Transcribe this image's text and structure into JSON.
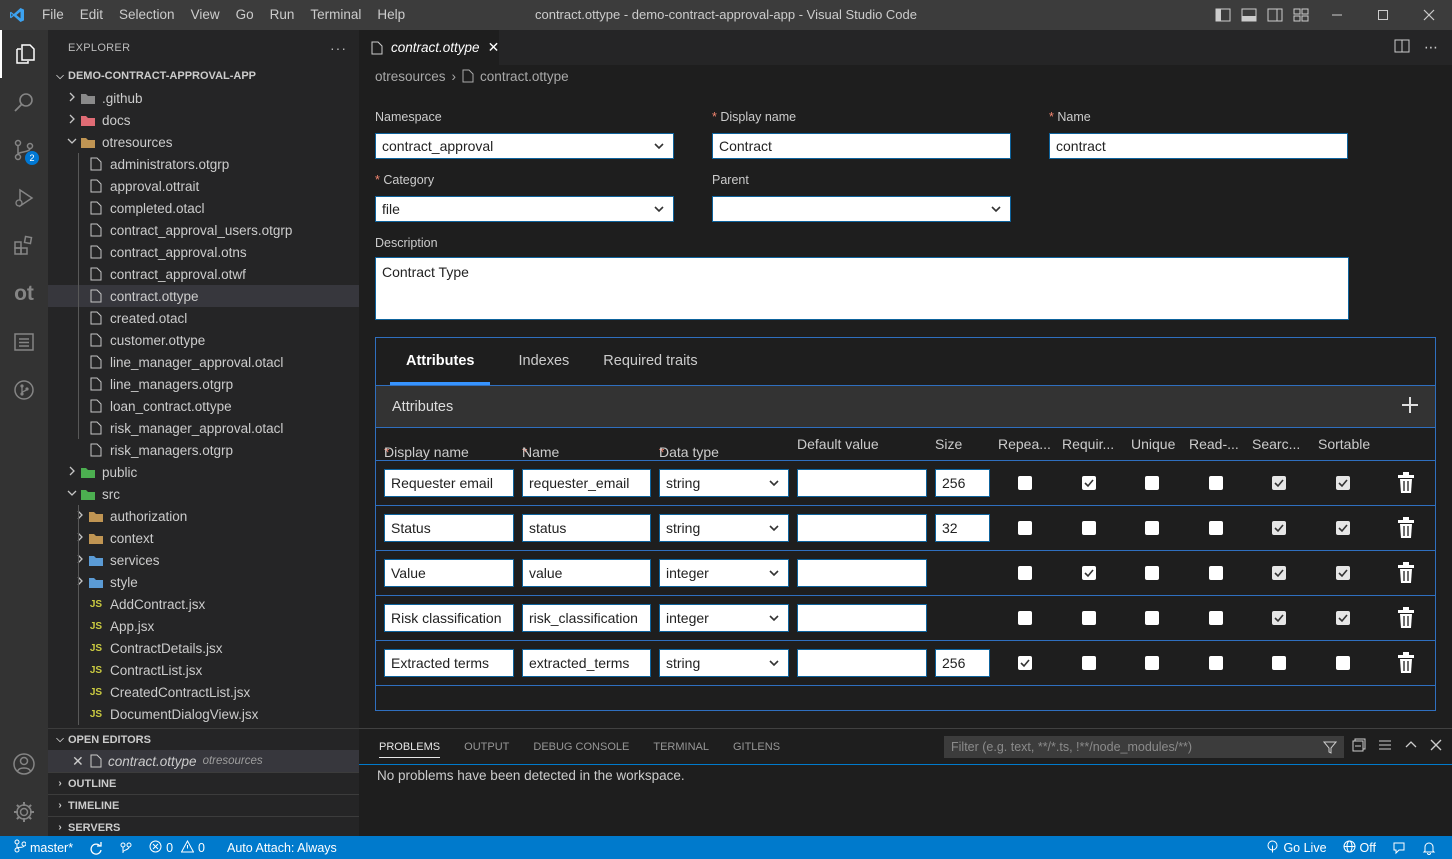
{
  "titlebar": {
    "menu": [
      "File",
      "Edit",
      "Selection",
      "View",
      "Go",
      "Run",
      "Terminal",
      "Help"
    ],
    "window_title": "contract.ottype - demo-contract-approval-app - Visual Studio Code"
  },
  "activity": {
    "scm_badge": "2",
    "ot_label": "ot"
  },
  "explorer": {
    "header": "EXPLORER",
    "more": "···",
    "root": "DEMO-CONTRACT-APPROVAL-APP",
    "items": [
      {
        "label": ".github",
        "type": "folder",
        "icon": "github-folder",
        "depth": 0,
        "open": false
      },
      {
        "label": "docs",
        "type": "folder",
        "icon": "docs-folder",
        "depth": 0,
        "open": false
      },
      {
        "label": "otresources",
        "type": "folder",
        "icon": "folder",
        "depth": 0,
        "open": true
      },
      {
        "label": "administrators.otgrp",
        "type": "file",
        "depth": 1
      },
      {
        "label": "approval.ottrait",
        "type": "file",
        "depth": 1
      },
      {
        "label": "completed.otacl",
        "type": "file",
        "depth": 1
      },
      {
        "label": "contract_approval_users.otgrp",
        "type": "file",
        "depth": 1
      },
      {
        "label": "contract_approval.otns",
        "type": "file",
        "depth": 1
      },
      {
        "label": "contract_approval.otwf",
        "type": "file",
        "depth": 1
      },
      {
        "label": "contract.ottype",
        "type": "file",
        "depth": 1,
        "selected": true
      },
      {
        "label": "created.otacl",
        "type": "file",
        "depth": 1
      },
      {
        "label": "customer.ottype",
        "type": "file",
        "depth": 1
      },
      {
        "label": "line_manager_approval.otacl",
        "type": "file",
        "depth": 1
      },
      {
        "label": "line_managers.otgrp",
        "type": "file",
        "depth": 1
      },
      {
        "label": "loan_contract.ottype",
        "type": "file",
        "depth": 1
      },
      {
        "label": "risk_manager_approval.otacl",
        "type": "file",
        "depth": 1
      },
      {
        "label": "risk_managers.otgrp",
        "type": "file",
        "depth": 1
      },
      {
        "label": "public",
        "type": "folder",
        "icon": "public-folder",
        "depth": 0,
        "open": false
      },
      {
        "label": "src",
        "type": "folder",
        "icon": "src-folder",
        "depth": 0,
        "open": true
      },
      {
        "label": "authorization",
        "type": "folder",
        "icon": "folder",
        "depth": 1,
        "open": false
      },
      {
        "label": "context",
        "type": "folder",
        "icon": "folder",
        "depth": 1,
        "open": false
      },
      {
        "label": "services",
        "type": "folder",
        "icon": "services-folder",
        "depth": 1,
        "open": false
      },
      {
        "label": "style",
        "type": "folder",
        "icon": "style-folder",
        "depth": 1,
        "open": false
      },
      {
        "label": "AddContract.jsx",
        "type": "js",
        "depth": 1
      },
      {
        "label": "App.jsx",
        "type": "js",
        "depth": 1
      },
      {
        "label": "ContractDetails.jsx",
        "type": "js",
        "depth": 1
      },
      {
        "label": "ContractList.jsx",
        "type": "js",
        "depth": 1
      },
      {
        "label": "CreatedContractList.jsx",
        "type": "js",
        "depth": 1
      },
      {
        "label": "DocumentDialogView.jsx",
        "type": "js",
        "depth": 1
      }
    ],
    "js_icon_text": "JS",
    "open_editors": {
      "title": "OPEN EDITORS",
      "file": "contract.ottype",
      "folder": "otresources"
    },
    "sections": [
      "OUTLINE",
      "TIMELINE",
      "SERVERS"
    ]
  },
  "editor": {
    "tab": "contract.ottype",
    "breadcrumb": [
      "otresources",
      "contract.ottype"
    ],
    "form": {
      "namespace_label": "Namespace",
      "namespace_value": "contract_approval",
      "display_name_label": "Display name",
      "display_name_value": "Contract",
      "name_label": "Name",
      "name_value": "contract",
      "category_label": "Category",
      "category_value": "file",
      "parent_label": "Parent",
      "parent_value": "",
      "description_label": "Description",
      "description_value": "Contract Type",
      "required_mark": "*"
    },
    "subtabs": [
      "Attributes",
      "Indexes",
      "Required traits"
    ],
    "attributes_title": "Attributes",
    "add_label": "+",
    "columns": {
      "display_name": "Display name",
      "name": "Name",
      "data_type": "Data type",
      "default_value": "Default value",
      "size": "Size",
      "repeating": "Repea...",
      "required": "Requir...",
      "unique": "Unique",
      "readonly": "Read-...",
      "searchable": "Searc...",
      "sortable": "Sortable"
    },
    "rows": [
      {
        "display_name": "Requester email",
        "name": "requester_email",
        "data_type": "string",
        "default": "",
        "size": "256",
        "flags": {
          "repeating": false,
          "required": true,
          "unique": false,
          "readonly": false,
          "searchable": true,
          "sortable": true
        }
      },
      {
        "display_name": "Status",
        "name": "status",
        "data_type": "string",
        "default": "",
        "size": "32",
        "flags": {
          "repeating": false,
          "required": false,
          "unique": false,
          "readonly": false,
          "searchable": true,
          "sortable": true
        }
      },
      {
        "display_name": "Value",
        "name": "value",
        "data_type": "integer",
        "default": "",
        "size": null,
        "flags": {
          "repeating": false,
          "required": true,
          "unique": false,
          "readonly": false,
          "searchable": true,
          "sortable": true
        }
      },
      {
        "display_name": "Risk classification",
        "name": "risk_classification",
        "data_type": "integer",
        "default": "",
        "size": null,
        "flags": {
          "repeating": false,
          "required": false,
          "unique": false,
          "readonly": false,
          "searchable": true,
          "sortable": true
        }
      },
      {
        "display_name": "Extracted terms",
        "name": "extracted_terms",
        "data_type": "string",
        "default": "",
        "size": "256",
        "flags": {
          "repeating": true,
          "required": false,
          "unique": false,
          "readonly": false,
          "searchable": false,
          "sortable": false
        }
      }
    ]
  },
  "panel": {
    "tabs": [
      "PROBLEMS",
      "OUTPUT",
      "DEBUG CONSOLE",
      "TERMINAL",
      "GITLENS"
    ],
    "active_tab": "PROBLEMS",
    "filter_placeholder": "Filter (e.g. text, **/*.ts, !**/node_modules/**)",
    "message": "No problems have been detected in the workspace."
  },
  "statusbar": {
    "branch": "master*",
    "errors": "0",
    "warnings": "0",
    "auto_attach": "Auto Attach: Always",
    "go_live": "Go Live",
    "off": "Off"
  },
  "colors": {
    "accent": "#007acc",
    "required": "#f48771",
    "js": "#cbcb41"
  }
}
